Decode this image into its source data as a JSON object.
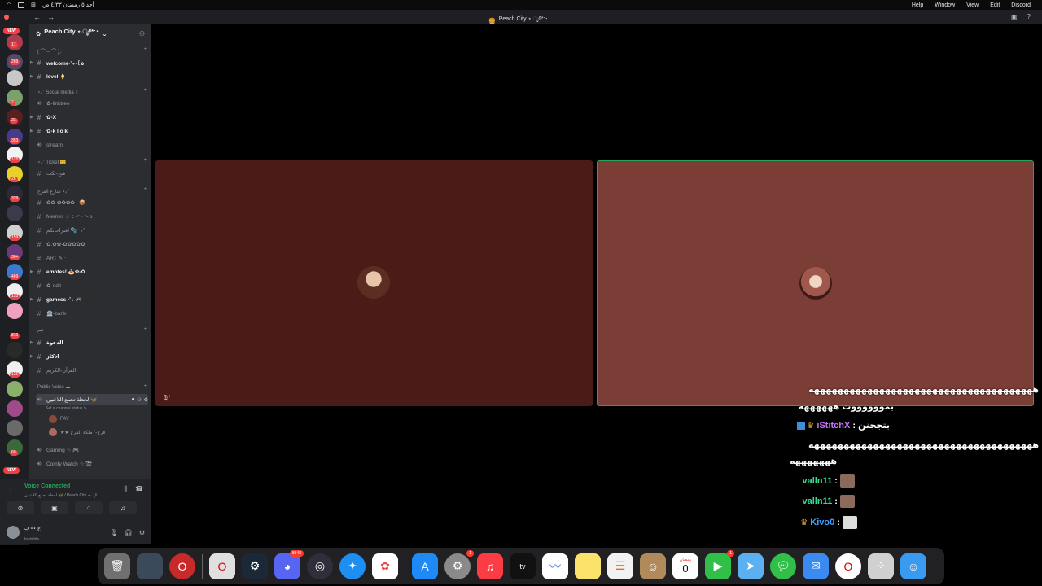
{
  "menubar": {
    "left_text": "أحد ٥ رمضان ٤:٣٣ ص",
    "menus": [
      "Help",
      "Window",
      "View",
      "Edit",
      "Discord"
    ]
  },
  "window": {
    "title": "Peach City ⋆.ೃ࿔*:･"
  },
  "server_rail": {
    "badges": [
      "NEW",
      "17",
      "269",
      "2",
      "2",
      "23",
      "353",
      "125",
      "26",
      "329",
      "26",
      "159",
      "36+",
      "469",
      "133",
      "810",
      "126",
      "1",
      "60",
      "18",
      "NEW"
    ]
  },
  "guild": {
    "name": "Peach City ⋆.ೃ࿔*:･"
  },
  "categories": [
    {
      "label": "(  ⌒ ─ ⌒ )◞",
      "top": 0
    },
    {
      "label": "⋆｡˚ Social media ☾",
      "top": 0
    },
    {
      "label": "⋆｡˚ Ticket 🎫",
      "top": 0
    },
    {
      "label": "شارع الفرح ⋆｡˚",
      "top": 0
    },
    {
      "label": "تيم",
      "top": 0
    },
    {
      "label": "Public Voice ☁",
      "top": 0
    }
  ],
  "channels": [
    "welcome·˚₊‧꒰ა",
    "level 🍦",
    "✿-linktree",
    "✿-X",
    "✿-k l o k",
    "stream",
    "فتح-تكت",
    "✿✿-✿✿✿✿ ! 📦",
    "Memes ☆ ૮ ˶ᵔ ᵕ ᵔ˶ ა",
    "افتراحاتكم 🫧 ‧₊˚",
    "✿.✿✿-✿✿✿✿✿",
    "ART ✎ ‧",
    "emotes! 🍝✿-✿",
    "✿-edit",
    "gamess ‧˚₊ 🎮",
    "🏦-bank",
    "الدعوة",
    "اذكار",
    "القرآن-الكريم",
    "لحظة تجمع اللاعبين 🦋",
    "Gaming ☆ 🎮",
    "Comfy Watch ☆ 🎬"
  ],
  "voice_channel": {
    "status_placeholder": "Set a channel status ✎",
    "members": [
      "FAY",
      "★★ فرح-˚ ملكة الفرح"
    ]
  },
  "voice_panel": {
    "status": "Voice Connected",
    "sub": "لحظة تجمع اللاعبين 🦋 / Peach City ⋆.ೃ࿔"
  },
  "user_panel": {
    "name": "ف ࿔⋆ خ",
    "status": "Invisible"
  },
  "chat": [
    {
      "text": "ههههههههههههههههههههههههههههههههههههههه"
    },
    {
      "text": "بمووووووت ههههههه"
    },
    {
      "name": "iStitchX",
      "sep": " : ",
      "text": "بتججنن",
      "name_color": "#c174f5"
    },
    {
      "text": "ههههههههههههههههههههههههههههههههههههههه"
    },
    {
      "text": "هههههههه"
    },
    {
      "name": "valln11",
      "sep": " : ",
      "name_color": "#2fe08f"
    },
    {
      "name": "valln11",
      "sep": " : ",
      "name_color": "#2fe08f"
    },
    {
      "name": "Kivo0",
      "sep": " : ",
      "name_color": "#3fa0ff"
    }
  ],
  "dock": {
    "badges": {
      "discord": "8648",
      "settings": "1",
      "facetime": "1"
    },
    "calendar": {
      "month": "رمضان",
      "day": "0"
    }
  },
  "colors": {
    "tile_a": "#4a1b17",
    "tile_b": "#7a3e36",
    "speaking": "#23a55a",
    "unread_badge": "#f23f43"
  }
}
